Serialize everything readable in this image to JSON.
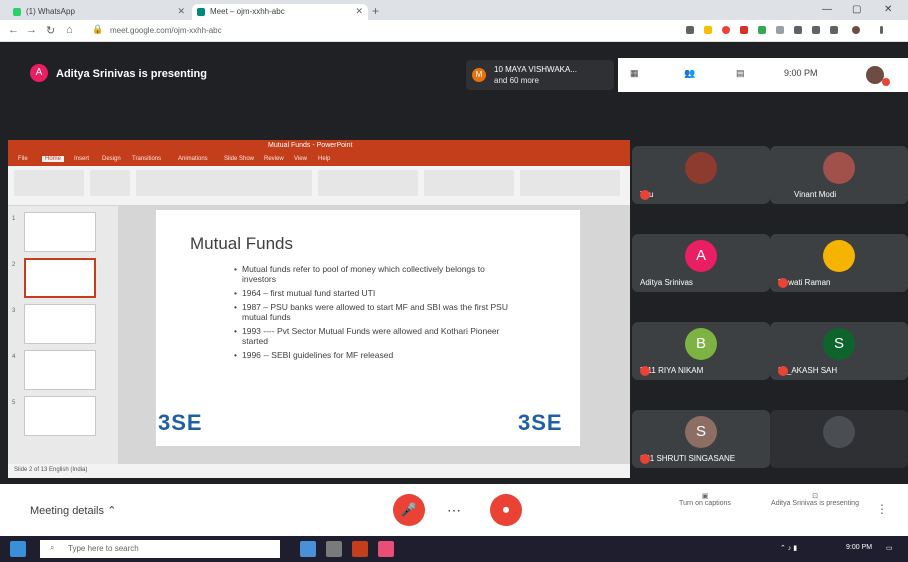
{
  "browser": {
    "tabs": [
      {
        "title": "(1) WhatsApp",
        "color": "#25d366"
      },
      {
        "title": "Meet – ojm-xxhh-abc",
        "color": "#00897b"
      }
    ],
    "url": "meet.google.com/ojm-xxhh-abc"
  },
  "meet": {
    "presenter_text": "Aditya Srinivas is presenting",
    "presenter_initial": "A",
    "pinned": {
      "line1": "10 MAYA VISHWAKA...",
      "line2": "and 60 more",
      "initial": "M"
    },
    "time": "9:00 PM",
    "meeting_details": "Meeting details"
  },
  "ppt": {
    "title": "Mutual Funds - PowerPoint",
    "tabs": [
      "File",
      "Home",
      "Insert",
      "Design",
      "Transitions",
      "Animations",
      "Slide Show",
      "Review",
      "View",
      "Help"
    ],
    "slide_title": "Mutual Funds",
    "bullets": [
      "Mutual funds refer to pool of money which collectively belongs to investors",
      "1964 – first mutual fund started UTI",
      "1987 – PSU banks were allowed to start MF and SBI was the first PSU mutual funds",
      "1993 ---- Pvt Sector Mutual Funds were allowed and Kothari Pioneer started",
      "1996 -- SEBI guidelines for MF released"
    ],
    "logo_left": "3SE",
    "logo_right": "3SE",
    "status": "Slide 2 of 13  English (India)"
  },
  "participants": [
    {
      "name": "You",
      "initial": "",
      "color": "#8d3a2f",
      "muted": true
    },
    {
      "name": "Vinant Modi",
      "initial": "",
      "color": "#a2504a",
      "muted": false
    },
    {
      "name": "Aditya Srinivas",
      "initial": "A",
      "color": "#e91e63",
      "muted": false
    },
    {
      "name": "Rewati Raman",
      "initial": "",
      "color": "#f4b400",
      "muted": true
    },
    {
      "name": "B 11 RIYA NIKAM",
      "initial": "B",
      "color": "#7cb342",
      "muted": true
    },
    {
      "name": "33_AKASH SAH",
      "initial": "S",
      "color": "#0d652d",
      "muted": true
    },
    {
      "name": "S31 SHRUTI SINGASANE",
      "initial": "S",
      "color": "#8d6e63",
      "muted": true
    },
    {
      "name": "",
      "initial": "",
      "color": "#3c4043",
      "muted": true
    }
  ],
  "controls": {
    "mic_icon": "mic-off-icon",
    "more": "⋯",
    "cam_icon": "camera-off-icon",
    "right1": "Turn on captions",
    "right2": "Aditya Srinivas is presenting"
  },
  "taskbar": {
    "search_placeholder": "Type here to search",
    "time": "9:00 PM"
  }
}
